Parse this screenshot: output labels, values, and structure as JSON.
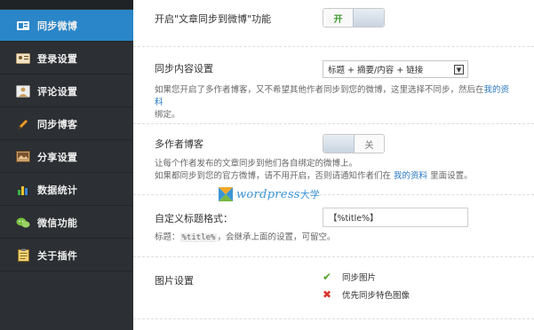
{
  "sidebar": {
    "items": [
      {
        "label": "同步微博",
        "icon": "weibo-icon",
        "active": true
      },
      {
        "label": "登录设置",
        "icon": "login-card-icon"
      },
      {
        "label": "评论设置",
        "icon": "comment-user-icon"
      },
      {
        "label": "同步博客",
        "icon": "pencil-icon"
      },
      {
        "label": "分享设置",
        "icon": "share-image-icon"
      },
      {
        "label": "数据统计",
        "icon": "bar-chart-icon"
      },
      {
        "label": "微信功能",
        "icon": "wechat-icon"
      },
      {
        "label": "关于插件",
        "icon": "clipboard-icon"
      }
    ]
  },
  "settings": {
    "sync_toggle": {
      "label": "开启\"文章同步到微博\"功能",
      "state_text": "开"
    },
    "sync_content": {
      "label": "同步内容设置",
      "selected": "标题 + 摘要/内容 + 链接",
      "desc_prefix": "如果您开启了多作者博客，又不希望其他作者同步到您的微博，这里选择不同步，然后在",
      "desc_link": "我的资料",
      "desc_suffix": "绑定。"
    },
    "multi_author": {
      "label": "多作者博客",
      "state_text": "关",
      "desc_line1": "让每个作者发布的文章同步到他们各自绑定的微博上。",
      "desc_line2_prefix": "如果都同步到您的官方微博，请不用开启，否则请通知作者们在",
      "desc_link": "我的资料",
      "desc_line2_suffix": "里面设置。"
    },
    "custom_title": {
      "label": "自定义标题格式：",
      "value": "【%title%】",
      "desc_prefix": "标题：",
      "desc_code": "%title%",
      "desc_suffix": "，会继承上面的设置，可留空。"
    },
    "image": {
      "label": "图片设置",
      "options": [
        {
          "text": "同步图片",
          "mark": "✔",
          "checked": true
        },
        {
          "text": "优先同步特色图像",
          "mark": "✖",
          "checked": false
        }
      ]
    }
  },
  "watermark": {
    "text": "wordpress",
    "cn": "大学"
  },
  "colors": {
    "accent": "#2a86c8",
    "sidebar": "#2c2f33",
    "link": "#2a78c2"
  }
}
